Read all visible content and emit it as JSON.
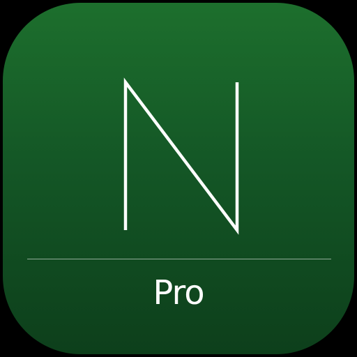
{
  "icon": {
    "letter": "N",
    "label": "Pro",
    "colors": {
      "background_top": "#1d6f2d",
      "background_mid": "#145726",
      "background_bottom": "#0d3f1b",
      "foreground": "#ffffff",
      "outer": "#000000"
    }
  }
}
